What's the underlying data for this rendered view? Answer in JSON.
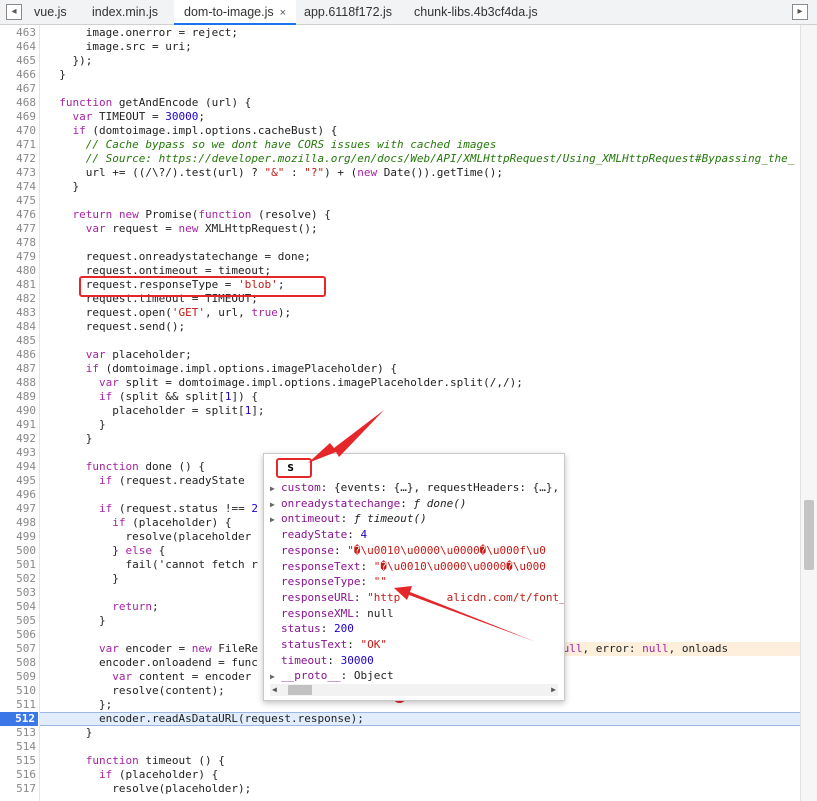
{
  "tabs": [
    {
      "label": "vue.js"
    },
    {
      "label": "index.min.js"
    },
    {
      "label": "dom-to-image.js",
      "active": true,
      "close": "×"
    },
    {
      "label": "app.6118f172.js"
    },
    {
      "label": "chunk-libs.4b3cf4da.js"
    }
  ],
  "lines": [
    {
      "n": "463",
      "t": "      image.onerror = reject;"
    },
    {
      "n": "464",
      "t": "      image.src = uri;"
    },
    {
      "n": "465",
      "t": "    });"
    },
    {
      "n": "466",
      "t": "  }"
    },
    {
      "n": "467",
      "t": ""
    },
    {
      "n": "468",
      "t": "  function getAndEncode (url) {"
    },
    {
      "n": "469",
      "t": "    var TIMEOUT = 30000;"
    },
    {
      "n": "470",
      "t": "    if (domtoimage.impl.options.cacheBust) {"
    },
    {
      "n": "471",
      "t": "      // Cache bypass so we dont have CORS issues with cached images"
    },
    {
      "n": "472",
      "t": "      // Source: https://developer.mozilla.org/en/docs/Web/API/XMLHttpRequest/Using_XMLHttpRequest#Bypassing_the_"
    },
    {
      "n": "473",
      "t": "      url += ((/\\?/).test(url) ? \"&\" : \"?\") + (new Date()).getTime();"
    },
    {
      "n": "474",
      "t": "    }"
    },
    {
      "n": "475",
      "t": ""
    },
    {
      "n": "476",
      "t": "    return new Promise(function (resolve) {"
    },
    {
      "n": "477",
      "t": "      var request = new XMLHttpRequest();"
    },
    {
      "n": "478",
      "t": ""
    },
    {
      "n": "479",
      "t": "      request.onreadystatechange = done;"
    },
    {
      "n": "480",
      "t": "      request.ontimeout = timeout;"
    },
    {
      "n": "481",
      "t": "      request.responseType = 'blob';"
    },
    {
      "n": "482",
      "t": "      request.timeout = TIMEOUT;"
    },
    {
      "n": "483",
      "t": "      request.open('GET', url, true);"
    },
    {
      "n": "484",
      "t": "      request.send();"
    },
    {
      "n": "485",
      "t": ""
    },
    {
      "n": "486",
      "t": "      var placeholder;"
    },
    {
      "n": "487",
      "t": "      if (domtoimage.impl.options.imagePlaceholder) {"
    },
    {
      "n": "488",
      "t": "        var split = domtoimage.impl.options.imagePlaceholder.split(/,/);"
    },
    {
      "n": "489",
      "t": "        if (split && split[1]) {"
    },
    {
      "n": "490",
      "t": "          placeholder = split[1];"
    },
    {
      "n": "491",
      "t": "        }"
    },
    {
      "n": "492",
      "t": "      }"
    },
    {
      "n": "493",
      "t": ""
    },
    {
      "n": "494",
      "t": "      function done () {"
    },
    {
      "n": "495",
      "t": "        if (request.readyState"
    },
    {
      "n": "496",
      "t": ""
    },
    {
      "n": "497",
      "t": "        if (request.status !== 2"
    },
    {
      "n": "498",
      "t": "          if (placeholder) {"
    },
    {
      "n": "499",
      "t": "            resolve(placeholder"
    },
    {
      "n": "500",
      "t": "          } else {"
    },
    {
      "n": "501",
      "t": "            fail('cannot fetch r                                       tus);"
    },
    {
      "n": "502",
      "t": "          }"
    },
    {
      "n": "503",
      "t": ""
    },
    {
      "n": "504",
      "t": "          return;"
    },
    {
      "n": "505",
      "t": "        }"
    },
    {
      "n": "506",
      "t": ""
    },
    {
      "n": "507",
      "t": "        var encoder = new FileRe                                   , result: null, error: null, onloads"
    },
    {
      "n": "508",
      "t": "        encoder.onloadend = func"
    },
    {
      "n": "509",
      "t": "          var content = encoder"
    },
    {
      "n": "510",
      "t": "          resolve(content);"
    },
    {
      "n": "511",
      "t": "        };"
    },
    {
      "n": "512",
      "t": "        encoder.readAsDataURL(request.response);"
    },
    {
      "n": "513",
      "t": "      }"
    },
    {
      "n": "514",
      "t": ""
    },
    {
      "n": "515",
      "t": "      function timeout () {"
    },
    {
      "n": "516",
      "t": "        if (placeholder) {"
    },
    {
      "n": "517",
      "t": "          resolve(placeholder);"
    }
  ],
  "current_line": "512",
  "popup": {
    "header": "s",
    "props": [
      {
        "exp": true,
        "k": "custom",
        "v": "{events: {…}, requestHeaders: {…},",
        "cls": "pv"
      },
      {
        "exp": true,
        "k": "onreadystatechange",
        "v": "ƒ done()",
        "cls": "pf"
      },
      {
        "exp": true,
        "k": "ontimeout",
        "v": "ƒ timeout()",
        "cls": "pf"
      },
      {
        "exp": false,
        "k": "readyState",
        "v": "4",
        "cls": "pn"
      },
      {
        "exp": false,
        "k": "response",
        "v": "\"�\\u0010\\u0000\\u0000�\\u000f\\u0",
        "cls": "ps"
      },
      {
        "exp": false,
        "k": "responseText",
        "v": "\"�\\u0010\\u0000\\u0000�\\u000",
        "cls": "ps"
      },
      {
        "exp": false,
        "k": "responseType",
        "v": "\"\"",
        "cls": "ps"
      },
      {
        "exp": false,
        "k": "responseURL",
        "v": "\"http       alicdn.com/t/font_",
        "cls": "ps"
      },
      {
        "exp": false,
        "k": "responseXML",
        "v": "null",
        "cls": "pv"
      },
      {
        "exp": false,
        "k": "status",
        "v": "200",
        "cls": "pn"
      },
      {
        "exp": false,
        "k": "statusText",
        "v": "\"OK\"",
        "cls": "ps"
      },
      {
        "exp": false,
        "k": "timeout",
        "v": "30000",
        "cls": "pn"
      },
      {
        "exp": true,
        "k": "__proto__",
        "v": "Object",
        "cls": "pv"
      }
    ]
  },
  "icons": {
    "back": "back-icon",
    "forward": "forward-icon",
    "error": "error-icon"
  },
  "colors": {
    "annotation": "#e5262b",
    "current_line": "#3b78e7"
  }
}
